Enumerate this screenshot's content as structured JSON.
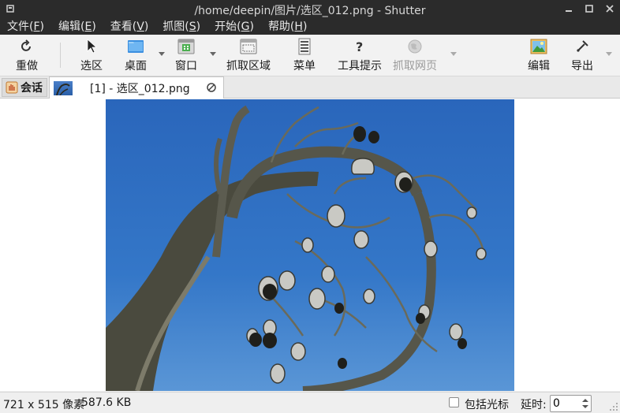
{
  "window": {
    "title": "/home/deepin/图片/选区_012.png - Shutter"
  },
  "menu": [
    {
      "label": "文件(",
      "key": "F",
      "end": ")"
    },
    {
      "label": "编辑(",
      "key": "E",
      "end": ")"
    },
    {
      "label": "查看(",
      "key": "V",
      "end": ")"
    },
    {
      "label": "抓图(",
      "key": "S",
      "end": ")"
    },
    {
      "label": "开始(",
      "key": "G",
      "end": ")"
    },
    {
      "label": "帮助(",
      "key": "H",
      "end": ")"
    }
  ],
  "toolbar": {
    "redo": "重做",
    "selection": "选区",
    "desktop": "桌面",
    "window": "窗口",
    "capture_area": "抓取区域",
    "menu": "菜单",
    "tooltip": "工具提示",
    "web": "抓取网页",
    "edit": "编辑",
    "export": "导出"
  },
  "tabs": {
    "session": "会话",
    "file": "[1] - 选区_012.png"
  },
  "status": {
    "dimensions": "721 x 515 像素",
    "filesize": "587.6 KB",
    "include_cursor": "包括光标",
    "delay_label": "延时:",
    "delay_value": "0"
  },
  "colors": {
    "titlebar": "#2b2b2b",
    "sky": "#2f6fc0"
  }
}
